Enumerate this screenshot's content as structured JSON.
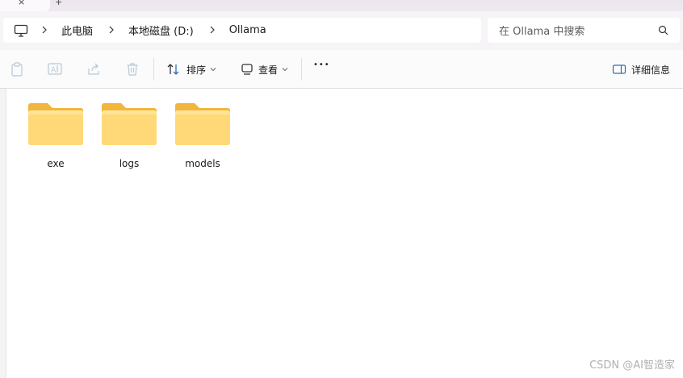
{
  "tabs": {
    "close_glyph": "×",
    "new_glyph": "+"
  },
  "breadcrumb": {
    "root_icon": "computer-icon",
    "items": [
      "此电脑",
      "本地磁盘 (D:)",
      "Ollama"
    ]
  },
  "search": {
    "placeholder": "在 Ollama 中搜索"
  },
  "toolbar": {
    "sort_label": "排序",
    "view_label": "查看",
    "more_glyph": "•••",
    "details_label": "详细信息"
  },
  "folders": [
    {
      "name": "exe"
    },
    {
      "name": "logs"
    },
    {
      "name": "models"
    }
  ],
  "watermark": "CSDN @AI智造家",
  "colors": {
    "folder_back": "#f2b63c",
    "folder_front": "#ffd977"
  }
}
